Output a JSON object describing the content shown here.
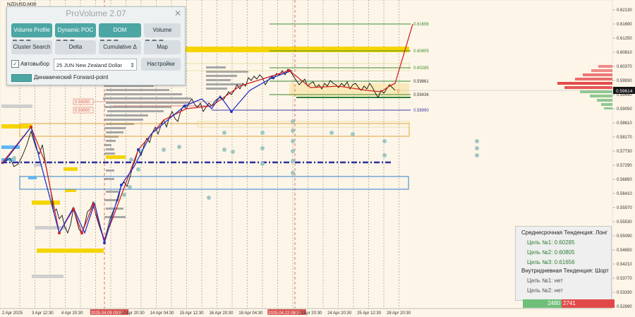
{
  "symbol": "NZDUSD,M30",
  "price_axis": {
    "ticks": [
      "0.62130",
      "0.61690",
      "0.61250",
      "0.60810",
      "0.60370",
      "0.59930",
      "0.59490",
      "0.59050",
      "0.58610",
      "0.58170",
      "0.57730",
      "0.57290",
      "0.56850",
      "0.56410",
      "0.55970",
      "0.55530",
      "0.55090",
      "0.54650",
      "0.54210",
      "0.53770",
      "0.53330",
      "0.52890"
    ],
    "current_price": "0.59614"
  },
  "time_axis": {
    "ticks": [
      "2 Apr 2025",
      "3 Apr 12:30",
      "4 Apr 20:30",
      "2025.04.09 03:00",
      "10 Apr 20:30",
      "14 Apr 04:30",
      "15 Apr 12:30",
      "16 Apr 20:30",
      "18 Apr 04:30",
      "2025.04.22 08:30",
      "23 Apr 20:30",
      "24 Apr 20:30",
      "25 Apr 12:30",
      "28 Apr 20:30"
    ],
    "highlighted": [
      "2025.04.09 03:00",
      "2025.04.22 08:30"
    ]
  },
  "level_labels": {
    "l1": "0.61656",
    "l2": "0.60805",
    "l3": "0.60285",
    "l4": "0.59861",
    "l5": "0.59436",
    "l6": "0.58990",
    "l7": "0.59250",
    "l8": "0.59000"
  },
  "panel": {
    "title": "ProVolume 2.07",
    "close": "✕",
    "buttons": {
      "volume_profile": "Volume Profile",
      "dynamic_poc": "Dynamic POC",
      "dom": "DOM",
      "volume": "Volume",
      "cluster_search": "Cluster Search",
      "delta": "Delta",
      "cumulative_delta": "Cumulative Δ",
      "map": "Map"
    },
    "sub_marks": {
      "m1": "▬ ▬ ▬",
      "m2": "▬ ▬ ▬",
      "m3": "▬ ▬ ▬",
      "m4": "▬ ▬ ▬"
    },
    "auto_select_label": "Автовыбор",
    "auto_select_checked": "✓",
    "instrument": "25 JUN New Zealand Dollar",
    "settings_label": "Настройки",
    "forward_point_label": "Динамический Forward-point"
  },
  "trend": {
    "mid_title": "Среднесрочная Тенденция: Лонг",
    "mid_target1": "Цель №1: 0.60285",
    "mid_target2": "Цель №2: 0.60805",
    "mid_target3": "Цель №3: 0.61656",
    "intraday_title": "Внутридневная Тенденция: Шорт",
    "intra_target1": "Цель №1: нет",
    "intra_target2": "Цель №2: нет"
  },
  "counter": {
    "buy": "2480",
    "sell": "2741"
  },
  "colors": {
    "background": "#fdf6e8",
    "accent": "#4ca6a4",
    "bull": "#2f7d32",
    "bear": "#e24a4a",
    "level_green": "#3c8a2e",
    "level_blue": "#3b3ba8",
    "zone_yellow": "#f5d400"
  }
}
